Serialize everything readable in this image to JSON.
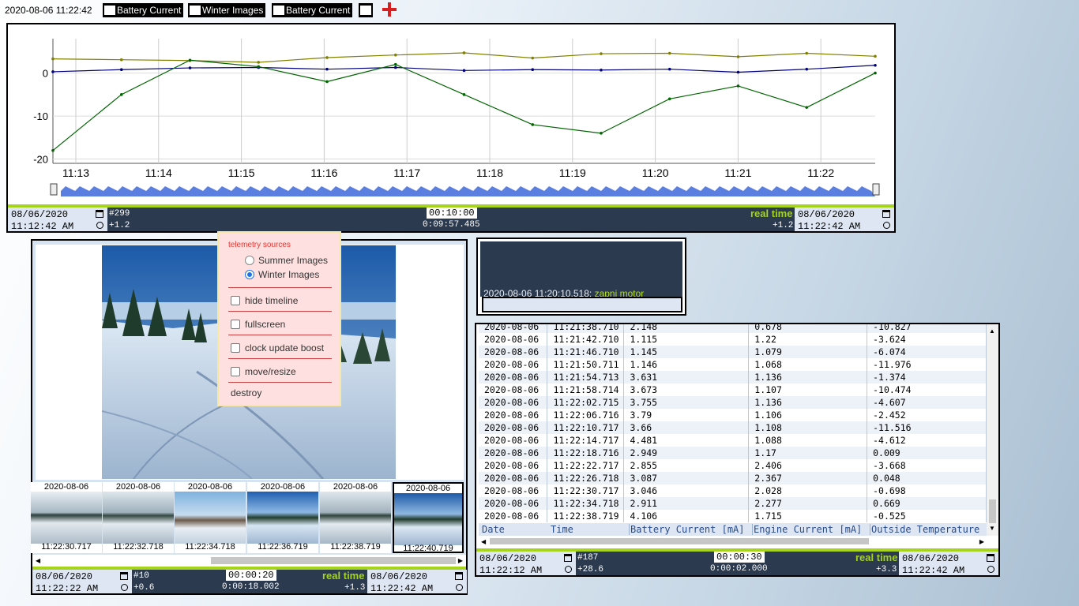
{
  "topbar": {
    "clock": "2020-08-06 11:22:42",
    "buttons": [
      "Battery Current",
      "Winter Images",
      "Battery Current"
    ]
  },
  "chart_data": {
    "type": "line",
    "x_ticks": [
      "11:13",
      "11:14",
      "11:15",
      "11:16",
      "11:17",
      "11:18",
      "11:19",
      "11:20",
      "11:21",
      "11:22"
    ],
    "y_ticks": [
      "0",
      "-10",
      "-20"
    ],
    "ylim": [
      -21,
      8
    ],
    "grid": true,
    "series": [
      {
        "color": "#808000",
        "values": [
          3.3,
          3.1,
          2.9,
          2.5,
          3.6,
          4.2,
          4.7,
          3.5,
          4.5,
          4.6,
          3.8,
          4.6,
          3.9
        ]
      },
      {
        "color": "#00007a",
        "values": [
          0.3,
          0.8,
          1.2,
          1.3,
          0.9,
          1.3,
          0.6,
          0.8,
          0.7,
          0.9,
          0.2,
          0.9,
          1.8
        ]
      },
      {
        "color": "#006400",
        "values": [
          -18,
          -5,
          3,
          1.5,
          -2,
          2,
          -5,
          -12,
          -14,
          -6,
          -3,
          -8,
          0
        ]
      }
    ]
  },
  "chart_panel": {
    "start_date": "08/06/2020",
    "start_time": "11:12:42 AM",
    "count": "#299",
    "offset": "+1.2",
    "window": "00:10:00",
    "elapsed": "0:09:57.485",
    "realtime": "real time",
    "end_offset": "+1.2",
    "end_date": "08/06/2020",
    "end_time": "11:22:42 AM"
  },
  "images_panel": {
    "thumbs": [
      {
        "date": "2020-08-06",
        "time": "11:22:30.717"
      },
      {
        "date": "2020-08-06",
        "time": "11:22:32.718"
      },
      {
        "date": "2020-08-06",
        "time": "11:22:34.718"
      },
      {
        "date": "2020-08-06",
        "time": "11:22:36.719"
      },
      {
        "date": "2020-08-06",
        "time": "11:22:38.719"
      },
      {
        "date": "2020-08-06",
        "time": "11:22:40.719"
      }
    ],
    "start_date": "08/06/2020",
    "start_time": "11:22:22 AM",
    "count": "#10",
    "offset": "+0.6",
    "window": "00:00:20",
    "elapsed": "0:00:18.002",
    "realtime": "real time",
    "end_offset": "+1.3",
    "end_date": "08/06/2020",
    "end_time": "11:22:42 AM"
  },
  "menu": {
    "header": "telemetry sources",
    "sources": [
      "Summer Images",
      "Winter Images"
    ],
    "selected": 1,
    "options": [
      "hide timeline",
      "fullscreen",
      "clock update boost",
      "move/resize"
    ],
    "destroy": "destroy"
  },
  "console": {
    "line_time": "2020-08-06 11:20:10.518:",
    "line_msg": "zapni motor"
  },
  "table_panel": {
    "rows": [
      [
        "2020-08-06",
        "11:21:38.710",
        "2.148",
        "0.678",
        "-10.827"
      ],
      [
        "2020-08-06",
        "11:21:42.710",
        "1.115",
        "1.22",
        "-3.624"
      ],
      [
        "2020-08-06",
        "11:21:46.710",
        "1.145",
        "1.079",
        "-6.074"
      ],
      [
        "2020-08-06",
        "11:21:50.711",
        "1.146",
        "1.068",
        "-11.976"
      ],
      [
        "2020-08-06",
        "11:21:54.713",
        "3.631",
        "1.136",
        "-1.374"
      ],
      [
        "2020-08-06",
        "11:21:58.714",
        "3.673",
        "1.107",
        "-10.474"
      ],
      [
        "2020-08-06",
        "11:22:02.715",
        "3.755",
        "1.136",
        "-4.607"
      ],
      [
        "2020-08-06",
        "11:22:06.716",
        "3.79",
        "1.106",
        "-2.452"
      ],
      [
        "2020-08-06",
        "11:22:10.717",
        "3.66",
        "1.108",
        "-11.516"
      ],
      [
        "2020-08-06",
        "11:22:14.717",
        "4.481",
        "1.088",
        "-4.612"
      ],
      [
        "2020-08-06",
        "11:22:18.716",
        "2.949",
        "1.17",
        "0.009"
      ],
      [
        "2020-08-06",
        "11:22:22.717",
        "2.855",
        "2.406",
        "-3.668"
      ],
      [
        "2020-08-06",
        "11:22:26.718",
        "3.087",
        "2.367",
        "0.048"
      ],
      [
        "2020-08-06",
        "11:22:30.717",
        "3.046",
        "2.028",
        "-0.698"
      ],
      [
        "2020-08-06",
        "11:22:34.718",
        "2.911",
        "2.277",
        "0.669"
      ],
      [
        "2020-08-06",
        "11:22:38.719",
        "4.106",
        "1.715",
        "-0.525"
      ]
    ],
    "headers": [
      "Date",
      "Time",
      "Battery Current [mA]",
      "Engine Current [mA]",
      "Outside Temperature"
    ],
    "start_date": "08/06/2020",
    "start_time": "11:22:12 AM",
    "count": "#187",
    "offset": "+28.6",
    "window": "00:00:30",
    "elapsed": "0:00:02.000",
    "realtime": "real time",
    "end_offset": "+3.3",
    "end_date": "08/06/2020",
    "end_time": "11:22:42 AM"
  }
}
